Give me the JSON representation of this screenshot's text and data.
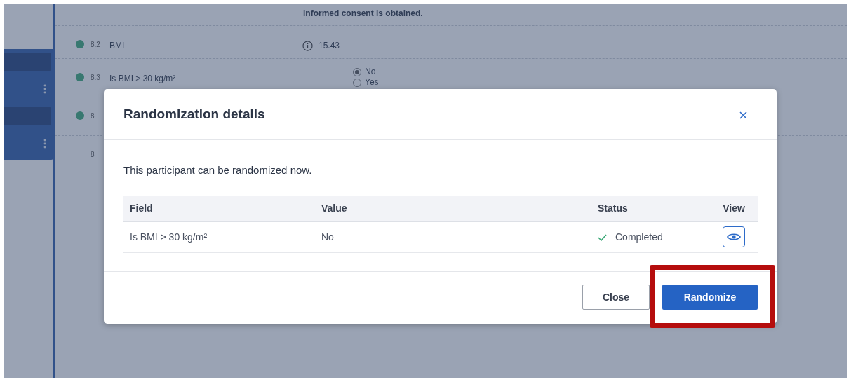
{
  "background": {
    "note": "informed consent is obtained.",
    "rows": [
      {
        "kind": "value",
        "status_dot": true,
        "number": "8.2",
        "label": "BMI",
        "value": "15.43"
      },
      {
        "kind": "radio",
        "status_dot": true,
        "number": "8.3",
        "label": "Is BMI > 30 kg/m²",
        "options": [
          {
            "label": "No",
            "selected": true
          },
          {
            "label": "Yes",
            "selected": false
          }
        ]
      },
      {
        "kind": "hidden",
        "status_dot": true,
        "number": "8"
      },
      {
        "kind": "hidden",
        "status_dot": false,
        "number": "8"
      }
    ]
  },
  "modal": {
    "title": "Randomization details",
    "message": "This participant can be randomized now.",
    "table": {
      "columns": [
        "Field",
        "Value",
        "Status",
        "View"
      ],
      "rows": [
        {
          "field": "Is BMI > 30 kg/m²",
          "value": "No",
          "status": "Completed",
          "completed": true
        }
      ]
    },
    "buttons": [
      {
        "label": "Close",
        "kind": "secondary"
      },
      {
        "label": "Randomize",
        "kind": "primary",
        "highlighted": true
      }
    ]
  }
}
